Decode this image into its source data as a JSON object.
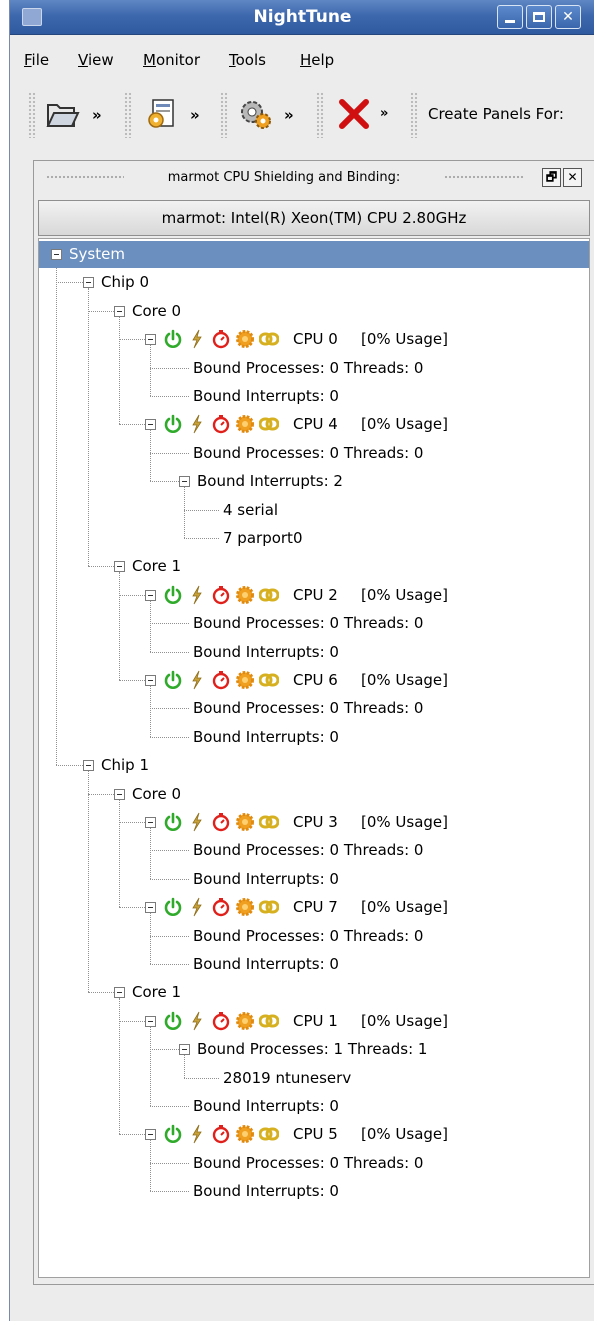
{
  "window": {
    "title": "NightTune"
  },
  "menu": [
    "File",
    "View",
    "Monitor",
    "Tools",
    "Help"
  ],
  "toolbar": {
    "chevron": "»",
    "create_panels_label": "Create Panels For:"
  },
  "panel": {
    "title": "marmot CPU Shielding and Binding:",
    "header": "marmot:  Intel(R) Xeon(TM) CPU 2.80GHz",
    "root": "System",
    "chips": [
      {
        "label": "Chip 0",
        "cores": [
          {
            "label": "Core 0",
            "cpus": [
              {
                "label": "CPU 0",
                "usage": "[0% Usage]",
                "processes": "Bound Processes: 0 Threads: 0",
                "interrupts": "Bound Interrupts: 0"
              },
              {
                "label": "CPU 4",
                "usage": "[0% Usage]",
                "processes": "Bound Processes: 0 Threads: 0",
                "interrupts": "Bound Interrupts: 2",
                "interrupt_items": [
                  "4  serial",
                  "7  parport0"
                ]
              }
            ]
          },
          {
            "label": "Core 1",
            "cpus": [
              {
                "label": "CPU 2",
                "usage": "[0% Usage]",
                "processes": "Bound Processes: 0 Threads: 0",
                "interrupts": "Bound Interrupts: 0"
              },
              {
                "label": "CPU 6",
                "usage": "[0% Usage]",
                "processes": "Bound Processes: 0 Threads: 0",
                "interrupts": "Bound Interrupts: 0"
              }
            ]
          }
        ]
      },
      {
        "label": "Chip 1",
        "cores": [
          {
            "label": "Core 0",
            "cpus": [
              {
                "label": "CPU 3",
                "usage": "[0% Usage]",
                "processes": "Bound Processes: 0 Threads: 0",
                "interrupts": "Bound Interrupts: 0"
              },
              {
                "label": "CPU 7",
                "usage": "[0% Usage]",
                "processes": "Bound Processes: 0 Threads: 0",
                "interrupts": "Bound Interrupts: 0"
              }
            ]
          },
          {
            "label": "Core 1",
            "cpus": [
              {
                "label": "CPU 1",
                "usage": "[0% Usage]",
                "processes": "Bound Processes: 1 Threads: 1",
                "process_items": [
                  "28019 ntuneserv"
                ],
                "interrupts": "Bound Interrupts: 0"
              },
              {
                "label": "CPU 5",
                "usage": "[0% Usage]",
                "processes": "Bound Processes: 0 Threads: 0",
                "interrupts": "Bound Interrupts: 0"
              }
            ]
          }
        ]
      }
    ]
  },
  "colors": {
    "titlebar": "#3d68ad",
    "selection": "#6b8fbf",
    "power": "#2faa2a",
    "bolt": "#c9a23a",
    "timer": "#e0201a",
    "gear": "#f0a020",
    "link": "#d7b020",
    "close_x": "#d01010"
  },
  "icons": [
    "open-folder-icon",
    "load-config-icon",
    "gears-icon",
    "delete-x-icon",
    "power-icon",
    "lightning-icon",
    "stopwatch-icon",
    "gear-icon",
    "link-icon"
  ]
}
